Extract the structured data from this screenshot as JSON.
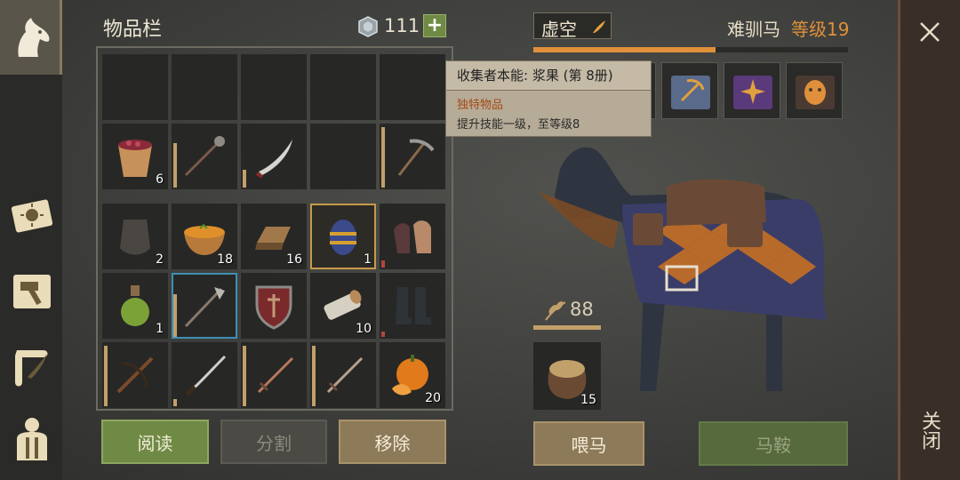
{
  "inventory": {
    "title": "物品栏",
    "currency_value": "111",
    "add_label": "+"
  },
  "slots": {
    "r2c1_count": "6",
    "r3c1_count": "2",
    "r3c2_count": "18",
    "r3c3_count": "16",
    "r3c4_count": "1",
    "r4c1_count": "1",
    "r4c4_count": "10",
    "r5c5_count": "20"
  },
  "buttons": {
    "read": "阅读",
    "split": "分割",
    "remove": "移除",
    "feed": "喂马",
    "saddle": "马鞍"
  },
  "horse": {
    "name": "虚空",
    "breed": "难驯马",
    "level": "等级19",
    "food_value": "88",
    "feed_bag_count": "15",
    "xp_progress": 0.58
  },
  "tooltip": {
    "title": "收集者本能: 浆果 (第 8册)",
    "subtitle": "独特物品",
    "description": "提升技能一级，至等级8"
  },
  "close_label": "关闭",
  "colors": {
    "accent_orange": "#e0903a",
    "button_green": "#6f8a44",
    "selected_gold": "#c79a4a",
    "selected_blue": "#3d8fb5"
  }
}
